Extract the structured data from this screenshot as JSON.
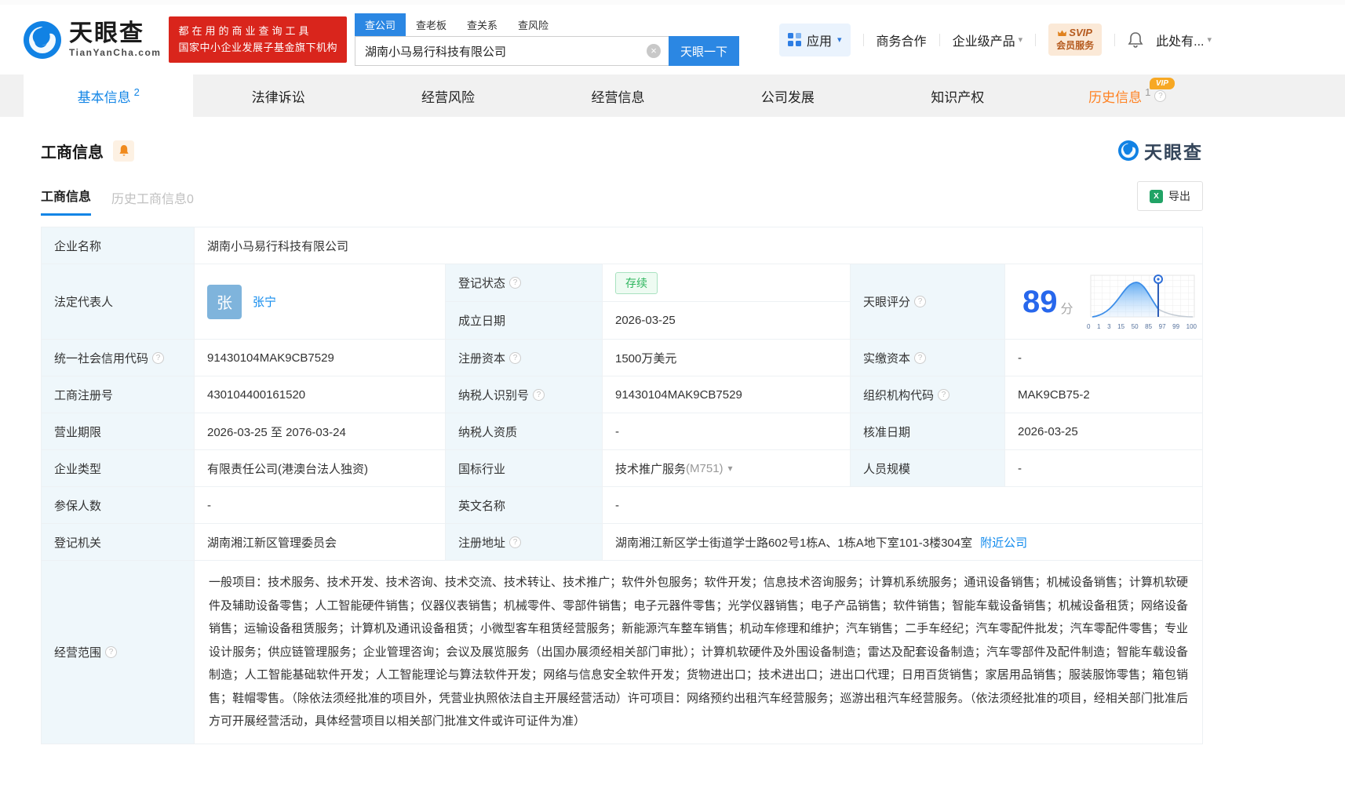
{
  "colors": {
    "brand_blue": "#2b87e3",
    "red": "#d9251c",
    "link_blue": "#128bed",
    "score_blue": "#2767ec",
    "green": "#2db55d",
    "orange": "#ff8223"
  },
  "header": {
    "logo": {
      "brand": "天眼查",
      "domain": "TianYanCha.com"
    },
    "slogan_line1": "都在用的商业查询工具",
    "slogan_line2": "国家中小企业发展子基金旗下机构",
    "search": {
      "tabs": [
        {
          "label": "查公司"
        },
        {
          "label": "查老板"
        },
        {
          "label": "查关系"
        },
        {
          "label": "查风险"
        }
      ],
      "value": "湖南小马易行科技有限公司",
      "button": "天眼一下"
    },
    "nav": {
      "apps": "应用",
      "biz_coop": "商务合作",
      "enterprise": "企业级产品",
      "svip_line1": "SVIP",
      "svip_line2": "会员服务",
      "more": "此处有..."
    }
  },
  "tabs": [
    {
      "label": "基本信息",
      "badge": "2"
    },
    {
      "label": "法律诉讼"
    },
    {
      "label": "经营风险"
    },
    {
      "label": "经营信息"
    },
    {
      "label": "公司发展"
    },
    {
      "label": "知识产权"
    },
    {
      "label": "历史信息",
      "badge": "1",
      "vip": "VIP"
    }
  ],
  "section": {
    "title": "工商信息",
    "watermark": "天眼查",
    "subtab_active": "工商信息",
    "subtab_dim": "历史工商信息0",
    "export_label": "导出"
  },
  "fields": {
    "company_name": {
      "label": "企业名称",
      "value": "湖南小马易行科技有限公司"
    },
    "legal_rep": {
      "label": "法定代表人",
      "avatar": "张",
      "value": "张宁"
    },
    "reg_status": {
      "label": "登记状态",
      "value": "存续"
    },
    "est_date": {
      "label": "成立日期",
      "value": "2026-03-25"
    },
    "score": {
      "label": "天眼评分",
      "value": "89",
      "unit": "分",
      "axis": [
        "0",
        "1",
        "3",
        "15",
        "50",
        "85",
        "97",
        "99",
        "100"
      ]
    },
    "credit_code": {
      "label": "统一社会信用代码",
      "value": "91430104MAK9CB7529"
    },
    "reg_capital": {
      "label": "注册资本",
      "value": "1500万美元"
    },
    "paid_capital": {
      "label": "实缴资本",
      "value": "-"
    },
    "reg_number": {
      "label": "工商注册号",
      "value": "430104400161520"
    },
    "taxpayer_id": {
      "label": "纳税人识别号",
      "value": "91430104MAK9CB7529"
    },
    "org_code": {
      "label": "组织机构代码",
      "value": "MAK9CB75-2"
    },
    "business_term": {
      "label": "营业期限",
      "value": "2026-03-25 至 2076-03-24"
    },
    "taxpayer_quality": {
      "label": "纳税人资质",
      "value": "-"
    },
    "approval_date": {
      "label": "核准日期",
      "value": "2026-03-25"
    },
    "company_type": {
      "label": "企业类型",
      "value": "有限责任公司(港澳台法人独资)"
    },
    "industry": {
      "label": "国标行业",
      "value": "技术推广服务",
      "code": "(M751)"
    },
    "staff_size": {
      "label": "人员规模",
      "value": "-"
    },
    "insured_count": {
      "label": "参保人数",
      "value": "-"
    },
    "english_name": {
      "label": "英文名称",
      "value": "-"
    },
    "reg_authority": {
      "label": "登记机关",
      "value": "湖南湘江新区管理委员会"
    },
    "reg_address": {
      "label": "注册地址",
      "value": "湖南湘江新区学士街道学士路602号1栋A、1栋A地下室101-3楼304室",
      "link": "附近公司"
    },
    "business_scope": {
      "label": "经营范围",
      "value": "一般项目：技术服务、技术开发、技术咨询、技术交流、技术转让、技术推广；软件外包服务；软件开发；信息技术咨询服务；计算机系统服务；通讯设备销售；机械设备销售；计算机软硬件及辅助设备零售；人工智能硬件销售；仪器仪表销售；机械零件、零部件销售；电子元器件零售；光学仪器销售；电子产品销售；软件销售；智能车载设备销售；机械设备租赁；网络设备销售；运输设备租赁服务；计算机及通讯设备租赁；小微型客车租赁经营服务；新能源汽车整车销售；机动车修理和维护；汽车销售；二手车经纪；汽车零配件批发；汽车零配件零售；专业设计服务；供应链管理服务；企业管理咨询；会议及展览服务（出国办展须经相关部门审批）；计算机软硬件及外围设备制造；雷达及配套设备制造；汽车零部件及配件制造；智能车载设备制造；人工智能基础软件开发；人工智能理论与算法软件开发；网络与信息安全软件开发；货物进出口；技术进出口；进出口代理；日用百货销售；家居用品销售；服装服饰零售；箱包销售；鞋帽零售。（除依法须经批准的项目外，凭营业执照依法自主开展经营活动）许可项目：网络预约出租汽车经营服务；巡游出租汽车经营服务。（依法须经批准的项目，经相关部门批准后方可开展经营活动，具体经营项目以相关部门批准文件或许可证件为准）"
    }
  },
  "chart_data": {
    "type": "area",
    "title": "天眼评分分布曲线",
    "x_ticks": [
      "0",
      "1",
      "3",
      "15",
      "50",
      "85",
      "97",
      "99",
      "100"
    ],
    "marker_value": 89,
    "series": [
      {
        "name": "score-distribution",
        "shape": "bell-curve",
        "marker_between": [
          "85",
          "97"
        ]
      }
    ]
  }
}
